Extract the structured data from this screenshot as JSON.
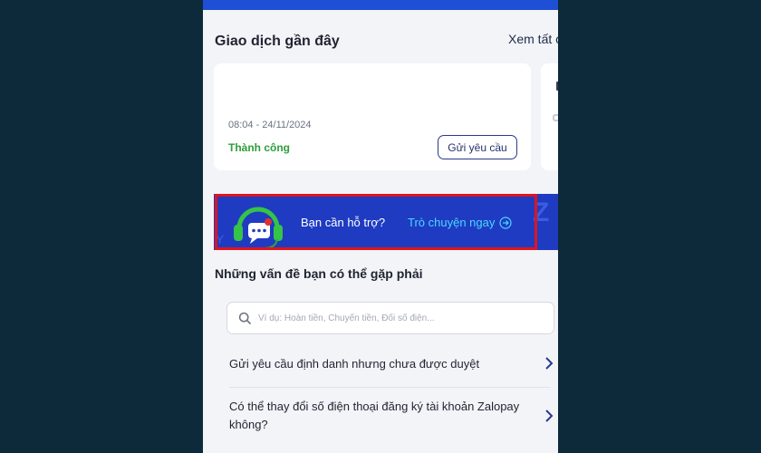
{
  "recent": {
    "title": "Giao dịch gần đây",
    "see_all": "Xem tất c",
    "transaction": {
      "time": "08:04 - 24/11/2024",
      "status": "Thành công",
      "request_button": "Gửi yêu cầu"
    }
  },
  "support_banner": {
    "text": "Bạn cần hỗ trợ?",
    "cta": "Trò chuyện ngay",
    "deco_left": "Y",
    "deco_right": "Z"
  },
  "issues": {
    "title": "Những vấn đề bạn có thể gặp phải",
    "search_placeholder": "Ví dụ: Hoàn tiền, Chuyển tiền, Đổi số điện...",
    "items": [
      {
        "label": "Gửi yêu cầu định danh nhưng chưa được duyệt"
      },
      {
        "label": "Có thể thay đổi số điện thoại đăng ký tài khoản Zalopay không?"
      }
    ]
  },
  "colors": {
    "banner_bg": "#1f3bc2",
    "highlight_border": "#e0141c",
    "success": "#2e9e3a",
    "cta": "#4ad7ff"
  },
  "icons": {
    "support": "headset-chat-icon",
    "cta": "arrow-circle-right-icon",
    "search": "search-icon",
    "chevron": "chevron-right-icon"
  }
}
